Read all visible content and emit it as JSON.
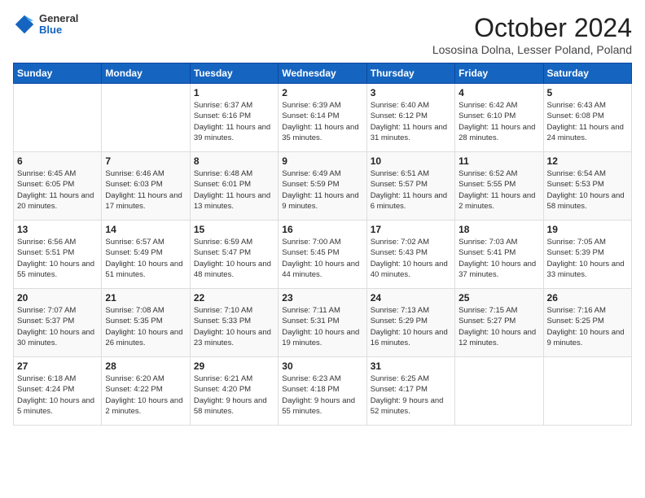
{
  "header": {
    "logo_general": "General",
    "logo_blue": "Blue",
    "month_title": "October 2024",
    "location": "Lososina Dolna, Lesser Poland, Poland"
  },
  "days_of_week": [
    "Sunday",
    "Monday",
    "Tuesday",
    "Wednesday",
    "Thursday",
    "Friday",
    "Saturday"
  ],
  "weeks": [
    [
      {
        "day": "",
        "info": ""
      },
      {
        "day": "",
        "info": ""
      },
      {
        "day": "1",
        "info": "Sunrise: 6:37 AM\nSunset: 6:16 PM\nDaylight: 11 hours and 39 minutes."
      },
      {
        "day": "2",
        "info": "Sunrise: 6:39 AM\nSunset: 6:14 PM\nDaylight: 11 hours and 35 minutes."
      },
      {
        "day": "3",
        "info": "Sunrise: 6:40 AM\nSunset: 6:12 PM\nDaylight: 11 hours and 31 minutes."
      },
      {
        "day": "4",
        "info": "Sunrise: 6:42 AM\nSunset: 6:10 PM\nDaylight: 11 hours and 28 minutes."
      },
      {
        "day": "5",
        "info": "Sunrise: 6:43 AM\nSunset: 6:08 PM\nDaylight: 11 hours and 24 minutes."
      }
    ],
    [
      {
        "day": "6",
        "info": "Sunrise: 6:45 AM\nSunset: 6:05 PM\nDaylight: 11 hours and 20 minutes."
      },
      {
        "day": "7",
        "info": "Sunrise: 6:46 AM\nSunset: 6:03 PM\nDaylight: 11 hours and 17 minutes."
      },
      {
        "day": "8",
        "info": "Sunrise: 6:48 AM\nSunset: 6:01 PM\nDaylight: 11 hours and 13 minutes."
      },
      {
        "day": "9",
        "info": "Sunrise: 6:49 AM\nSunset: 5:59 PM\nDaylight: 11 hours and 9 minutes."
      },
      {
        "day": "10",
        "info": "Sunrise: 6:51 AM\nSunset: 5:57 PM\nDaylight: 11 hours and 6 minutes."
      },
      {
        "day": "11",
        "info": "Sunrise: 6:52 AM\nSunset: 5:55 PM\nDaylight: 11 hours and 2 minutes."
      },
      {
        "day": "12",
        "info": "Sunrise: 6:54 AM\nSunset: 5:53 PM\nDaylight: 10 hours and 58 minutes."
      }
    ],
    [
      {
        "day": "13",
        "info": "Sunrise: 6:56 AM\nSunset: 5:51 PM\nDaylight: 10 hours and 55 minutes."
      },
      {
        "day": "14",
        "info": "Sunrise: 6:57 AM\nSunset: 5:49 PM\nDaylight: 10 hours and 51 minutes."
      },
      {
        "day": "15",
        "info": "Sunrise: 6:59 AM\nSunset: 5:47 PM\nDaylight: 10 hours and 48 minutes."
      },
      {
        "day": "16",
        "info": "Sunrise: 7:00 AM\nSunset: 5:45 PM\nDaylight: 10 hours and 44 minutes."
      },
      {
        "day": "17",
        "info": "Sunrise: 7:02 AM\nSunset: 5:43 PM\nDaylight: 10 hours and 40 minutes."
      },
      {
        "day": "18",
        "info": "Sunrise: 7:03 AM\nSunset: 5:41 PM\nDaylight: 10 hours and 37 minutes."
      },
      {
        "day": "19",
        "info": "Sunrise: 7:05 AM\nSunset: 5:39 PM\nDaylight: 10 hours and 33 minutes."
      }
    ],
    [
      {
        "day": "20",
        "info": "Sunrise: 7:07 AM\nSunset: 5:37 PM\nDaylight: 10 hours and 30 minutes."
      },
      {
        "day": "21",
        "info": "Sunrise: 7:08 AM\nSunset: 5:35 PM\nDaylight: 10 hours and 26 minutes."
      },
      {
        "day": "22",
        "info": "Sunrise: 7:10 AM\nSunset: 5:33 PM\nDaylight: 10 hours and 23 minutes."
      },
      {
        "day": "23",
        "info": "Sunrise: 7:11 AM\nSunset: 5:31 PM\nDaylight: 10 hours and 19 minutes."
      },
      {
        "day": "24",
        "info": "Sunrise: 7:13 AM\nSunset: 5:29 PM\nDaylight: 10 hours and 16 minutes."
      },
      {
        "day": "25",
        "info": "Sunrise: 7:15 AM\nSunset: 5:27 PM\nDaylight: 10 hours and 12 minutes."
      },
      {
        "day": "26",
        "info": "Sunrise: 7:16 AM\nSunset: 5:25 PM\nDaylight: 10 hours and 9 minutes."
      }
    ],
    [
      {
        "day": "27",
        "info": "Sunrise: 6:18 AM\nSunset: 4:24 PM\nDaylight: 10 hours and 5 minutes."
      },
      {
        "day": "28",
        "info": "Sunrise: 6:20 AM\nSunset: 4:22 PM\nDaylight: 10 hours and 2 minutes."
      },
      {
        "day": "29",
        "info": "Sunrise: 6:21 AM\nSunset: 4:20 PM\nDaylight: 9 hours and 58 minutes."
      },
      {
        "day": "30",
        "info": "Sunrise: 6:23 AM\nSunset: 4:18 PM\nDaylight: 9 hours and 55 minutes."
      },
      {
        "day": "31",
        "info": "Sunrise: 6:25 AM\nSunset: 4:17 PM\nDaylight: 9 hours and 52 minutes."
      },
      {
        "day": "",
        "info": ""
      },
      {
        "day": "",
        "info": ""
      }
    ]
  ]
}
